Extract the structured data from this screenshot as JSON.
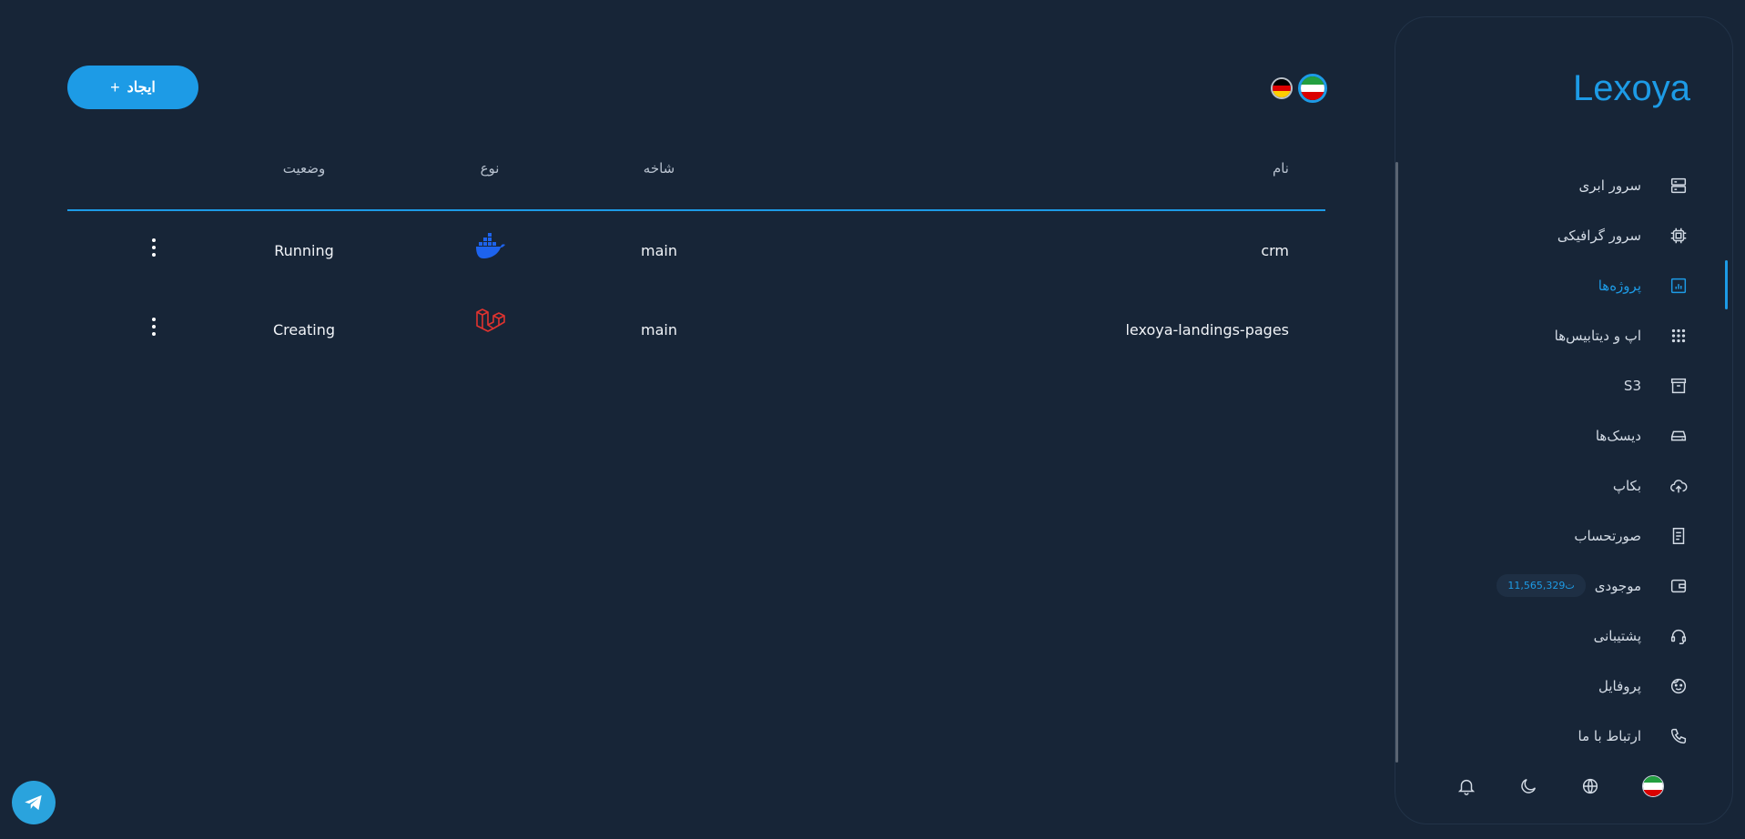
{
  "header": {
    "create_label": "ایجاد",
    "create_plus": "+"
  },
  "table": {
    "columns": {
      "name": "نام",
      "branch": "شاخه",
      "type": "نوع",
      "status": "وضعیت"
    },
    "rows": [
      {
        "name": "crm",
        "branch": "main",
        "type_icon": "docker-icon",
        "status": "Running"
      },
      {
        "name": "lexoya-landings-pages",
        "branch": "main",
        "type_icon": "laravel-icon",
        "status": "Creating"
      }
    ]
  },
  "sidebar": {
    "logo": "Lexoya",
    "items": [
      {
        "label": "سرور ابری",
        "icon": "server-icon"
      },
      {
        "label": "سرور گرافیکی",
        "icon": "chip-icon"
      },
      {
        "label": "پروژه‌ها",
        "icon": "chart-icon",
        "active": true
      },
      {
        "label": "اپ و دیتابیس‌ها",
        "icon": "grid-icon"
      },
      {
        "label": "S3",
        "icon": "archive-icon"
      },
      {
        "label": "دیسک‌ها",
        "icon": "disk-icon"
      },
      {
        "label": "بکاپ",
        "icon": "cloud-upload-icon"
      },
      {
        "label": "صورتحساب",
        "icon": "receipt-icon"
      },
      {
        "label": "موجودی",
        "icon": "wallet-icon",
        "badge": "11,565,329ت"
      },
      {
        "label": "پشتیبانی",
        "icon": "headset-icon"
      },
      {
        "label": "پروفایل",
        "icon": "face-icon"
      },
      {
        "label": "ارتباط با ما",
        "icon": "phone-icon"
      }
    ]
  },
  "colors": {
    "accent": "#1d9be6",
    "background": "#172537",
    "laravel": "#e0332f",
    "docker": "#1d63ed"
  }
}
